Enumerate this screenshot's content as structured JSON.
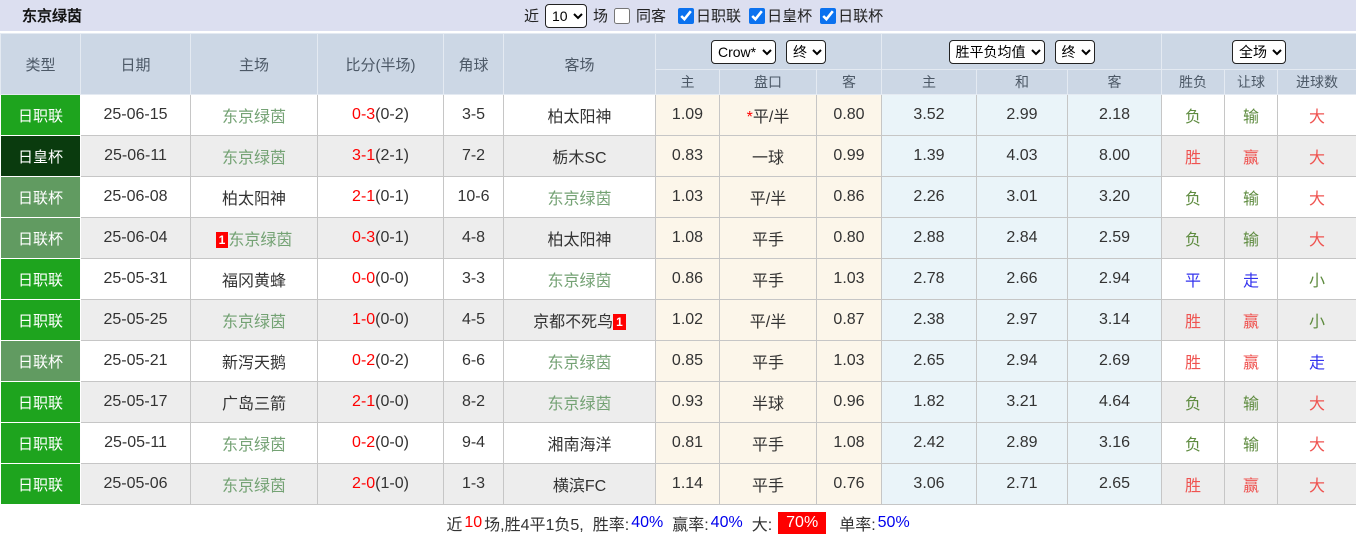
{
  "page": {
    "title": "东京绿茵"
  },
  "topbar": {
    "recent_label": "近",
    "recent_value": "10",
    "games_label": "场",
    "same_venue": {
      "label": "同客",
      "checked": false
    },
    "league_filters": [
      {
        "label": "日职联",
        "checked": true
      },
      {
        "label": "日皇杯",
        "checked": true
      },
      {
        "label": "日联杯",
        "checked": true
      }
    ]
  },
  "table": {
    "main_headers": [
      "类型",
      "日期",
      "主场",
      "比分(半场)",
      "角球",
      "客场"
    ],
    "selectors": {
      "bookmaker": "Crow*",
      "bookmaker_stage": "终",
      "average": "胜平负均值",
      "average_stage": "终",
      "scope": "全场"
    },
    "subheaders": [
      "主",
      "盘口",
      "客",
      "主",
      "和",
      "客",
      "胜负",
      "让球",
      "进球数"
    ],
    "rows": [
      {
        "type": "日职联",
        "type_key": "jzl",
        "date": "25-06-15",
        "home": {
          "name": "东京绿茵",
          "color": "green"
        },
        "score": {
          "full": "0-3",
          "half": "(0-2)"
        },
        "corners": "3-5",
        "away": {
          "name": "柏太阳神",
          "color": "dark"
        },
        "odds": {
          "home": "1.09",
          "handicap_mark": "*",
          "handicap": "平/半",
          "away": "0.80"
        },
        "avg": {
          "home": "3.52",
          "draw": "2.99",
          "away": "2.18"
        },
        "results": {
          "wdl": {
            "text": "负",
            "color": "green"
          },
          "handicap": {
            "text": "输",
            "color": "green"
          },
          "goals": {
            "text": "大",
            "color": "red"
          }
        }
      },
      {
        "type": "日皇杯",
        "type_key": "jhb",
        "date": "25-06-11",
        "home": {
          "name": "东京绿茵",
          "color": "green"
        },
        "score": {
          "full": "3-1",
          "half": "(2-1)"
        },
        "corners": "7-2",
        "away": {
          "name": "栃木SC",
          "color": "dark"
        },
        "odds": {
          "home": "0.83",
          "handicap": "一球",
          "away": "0.99"
        },
        "avg": {
          "home": "1.39",
          "draw": "4.03",
          "away": "8.00"
        },
        "results": {
          "wdl": {
            "text": "胜",
            "color": "red"
          },
          "handicap": {
            "text": "赢",
            "color": "red"
          },
          "goals": {
            "text": "大",
            "color": "red"
          }
        }
      },
      {
        "type": "日联杯",
        "type_key": "jlb",
        "date": "25-06-08",
        "home": {
          "name": "柏太阳神",
          "color": "dark"
        },
        "score": {
          "full": "2-1",
          "half": "(0-1)"
        },
        "corners": "10-6",
        "away": {
          "name": "东京绿茵",
          "color": "green"
        },
        "odds": {
          "home": "1.03",
          "handicap": "平/半",
          "away": "0.86"
        },
        "avg": {
          "home": "2.26",
          "draw": "3.01",
          "away": "3.20"
        },
        "results": {
          "wdl": {
            "text": "负",
            "color": "green"
          },
          "handicap": {
            "text": "输",
            "color": "green"
          },
          "goals": {
            "text": "大",
            "color": "red"
          }
        }
      },
      {
        "type": "日联杯",
        "type_key": "jlb",
        "date": "25-06-04",
        "home": {
          "badge": "1",
          "name": "东京绿茵",
          "color": "green"
        },
        "score": {
          "full": "0-3",
          "half": "(0-1)"
        },
        "corners": "4-8",
        "away": {
          "name": "柏太阳神",
          "color": "dark"
        },
        "odds": {
          "home": "1.08",
          "handicap": "平手",
          "away": "0.80"
        },
        "avg": {
          "home": "2.88",
          "draw": "2.84",
          "away": "2.59"
        },
        "results": {
          "wdl": {
            "text": "负",
            "color": "green"
          },
          "handicap": {
            "text": "输",
            "color": "green"
          },
          "goals": {
            "text": "大",
            "color": "red"
          }
        }
      },
      {
        "type": "日职联",
        "type_key": "jzl",
        "date": "25-05-31",
        "home": {
          "name": "福冈黄蜂",
          "color": "dark"
        },
        "score": {
          "full": "0-0",
          "half": "(0-0)"
        },
        "corners": "3-3",
        "away": {
          "name": "东京绿茵",
          "color": "green"
        },
        "odds": {
          "home": "0.86",
          "handicap": "平手",
          "away": "1.03"
        },
        "avg": {
          "home": "2.78",
          "draw": "2.66",
          "away": "2.94"
        },
        "results": {
          "wdl": {
            "text": "平",
            "color": "blue"
          },
          "handicap": {
            "text": "走",
            "color": "blue"
          },
          "goals": {
            "text": "小",
            "color": "green"
          }
        }
      },
      {
        "type": "日职联",
        "type_key": "jzl",
        "date": "25-05-25",
        "home": {
          "name": "东京绿茵",
          "color": "green"
        },
        "score": {
          "full": "1-0",
          "half": "(0-0)"
        },
        "corners": "4-5",
        "away": {
          "name": "京都不死鸟",
          "badge": "1",
          "color": "dark"
        },
        "odds": {
          "home": "1.02",
          "handicap": "平/半",
          "away": "0.87"
        },
        "avg": {
          "home": "2.38",
          "draw": "2.97",
          "away": "3.14"
        },
        "results": {
          "wdl": {
            "text": "胜",
            "color": "red"
          },
          "handicap": {
            "text": "赢",
            "color": "red"
          },
          "goals": {
            "text": "小",
            "color": "green"
          }
        }
      },
      {
        "type": "日联杯",
        "type_key": "jlb",
        "date": "25-05-21",
        "home": {
          "name": "新泻天鹅",
          "color": "dark"
        },
        "score": {
          "full": "0-2",
          "half": "(0-2)"
        },
        "corners": "6-6",
        "away": {
          "name": "东京绿茵",
          "color": "green"
        },
        "odds": {
          "home": "0.85",
          "handicap": "平手",
          "away": "1.03"
        },
        "avg": {
          "home": "2.65",
          "draw": "2.94",
          "away": "2.69"
        },
        "results": {
          "wdl": {
            "text": "胜",
            "color": "red"
          },
          "handicap": {
            "text": "赢",
            "color": "red"
          },
          "goals": {
            "text": "走",
            "color": "blue"
          }
        }
      },
      {
        "type": "日职联",
        "type_key": "jzl",
        "date": "25-05-17",
        "home": {
          "name": "广岛三箭",
          "color": "dark"
        },
        "score": {
          "full": "2-1",
          "half": "(0-0)"
        },
        "corners": "8-2",
        "away": {
          "name": "东京绿茵",
          "color": "green"
        },
        "odds": {
          "home": "0.93",
          "handicap": "半球",
          "away": "0.96"
        },
        "avg": {
          "home": "1.82",
          "draw": "3.21",
          "away": "4.64"
        },
        "results": {
          "wdl": {
            "text": "负",
            "color": "green"
          },
          "handicap": {
            "text": "输",
            "color": "green"
          },
          "goals": {
            "text": "大",
            "color": "red"
          }
        }
      },
      {
        "type": "日职联",
        "type_key": "jzl",
        "date": "25-05-11",
        "home": {
          "name": "东京绿茵",
          "color": "green"
        },
        "score": {
          "full": "0-2",
          "half": "(0-0)"
        },
        "corners": "9-4",
        "away": {
          "name": "湘南海洋",
          "color": "dark"
        },
        "odds": {
          "home": "0.81",
          "handicap": "平手",
          "away": "1.08"
        },
        "avg": {
          "home": "2.42",
          "draw": "2.89",
          "away": "3.16"
        },
        "results": {
          "wdl": {
            "text": "负",
            "color": "green"
          },
          "handicap": {
            "text": "输",
            "color": "green"
          },
          "goals": {
            "text": "大",
            "color": "red"
          }
        }
      },
      {
        "type": "日职联",
        "type_key": "jzl",
        "date": "25-05-06",
        "home": {
          "name": "东京绿茵",
          "color": "green"
        },
        "score": {
          "full": "2-0",
          "half": "(1-0)"
        },
        "corners": "1-3",
        "away": {
          "name": "横滨FC",
          "color": "dark"
        },
        "odds": {
          "home": "1.14",
          "handicap": "平手",
          "away": "0.76"
        },
        "avg": {
          "home": "3.06",
          "draw": "2.71",
          "away": "2.65"
        },
        "results": {
          "wdl": {
            "text": "胜",
            "color": "red"
          },
          "handicap": {
            "text": "赢",
            "color": "red"
          },
          "goals": {
            "text": "大",
            "color": "red"
          }
        }
      }
    ]
  },
  "footer": {
    "prefix": "近",
    "count": "10",
    "summary": "场,胜4平1负5,",
    "win_rate_label": "胜率:",
    "win_rate": "40%",
    "handicap_rate_label": "赢率:",
    "handicap_rate": "40%",
    "big_label": "大:",
    "big_rate": "70%",
    "single_label": "单率:",
    "single_rate": "50%"
  },
  "colors": {
    "score_red": "#ff0000",
    "result_red": "#ef5350",
    "result_green": "#5e8b3f",
    "result_blue": "#3333ee",
    "team_green": "#74a274",
    "league_jzl_green": "#1ea41e",
    "league_jhb_dark_green": "#0a3b0e",
    "league_jlb_gray_green": "#619b61",
    "stat_blue": "#0000ee",
    "topbar_bg": "#dcdff0",
    "header_bg": "#ccd7e5"
  }
}
